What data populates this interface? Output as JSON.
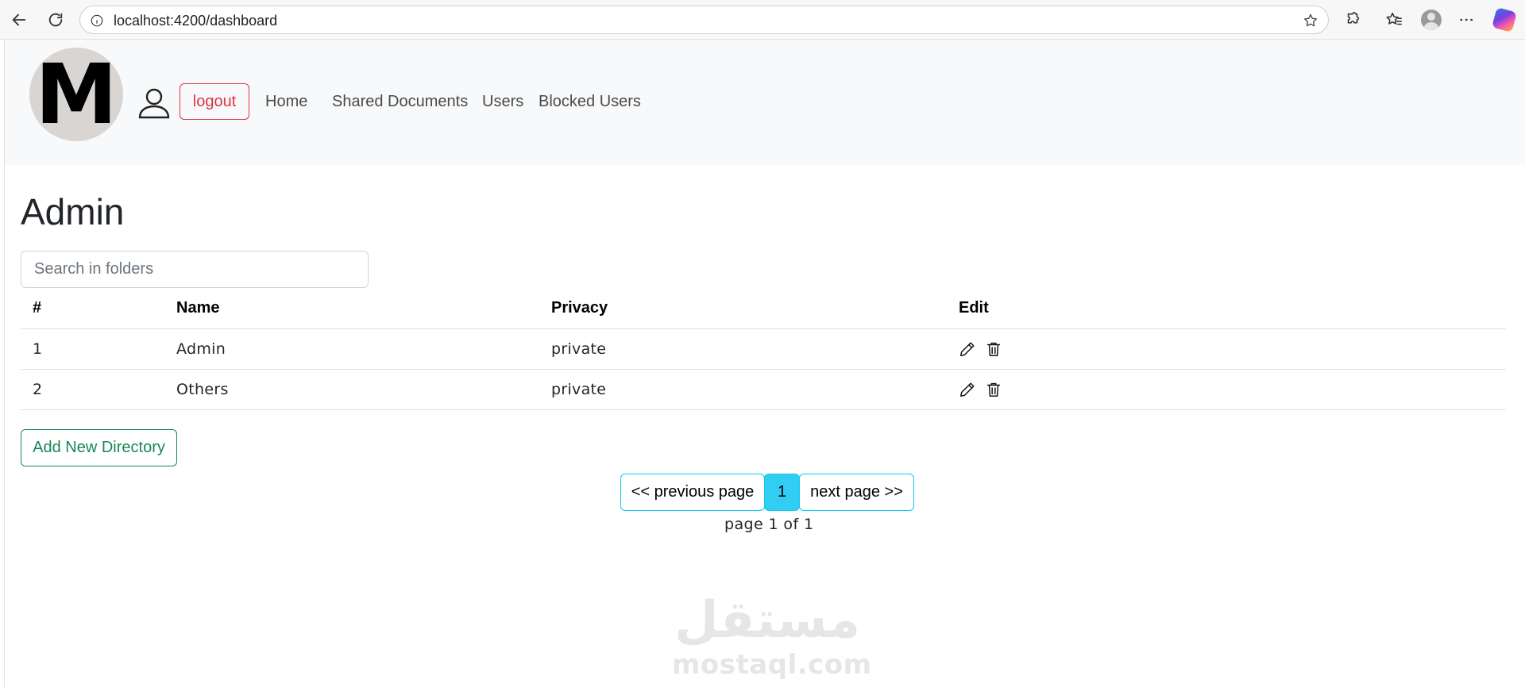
{
  "browser": {
    "url": "localhost:4200/dashboard",
    "icons": [
      "back-arrow-icon",
      "refresh-icon",
      "info-icon",
      "star-icon",
      "extensions-icon",
      "favorites-icon",
      "profile-icon",
      "more-icon",
      "copilot-icon"
    ]
  },
  "navbar": {
    "avatar_letter": "M",
    "logout_label": "logout",
    "links": [
      "Home",
      "Shared Documents",
      "Users",
      "Blocked Users"
    ]
  },
  "main": {
    "title": "Admin",
    "search_placeholder": "Search in folders",
    "table": {
      "headers": [
        "#",
        "Name",
        "Privacy",
        "Edit"
      ],
      "rows": [
        {
          "index": "1",
          "name": "Admin",
          "privacy": "private"
        },
        {
          "index": "2",
          "name": "Others",
          "privacy": "private"
        }
      ]
    },
    "add_button_label": "Add New Directory"
  },
  "pagination": {
    "prev_label": "<< previous page",
    "current": "1",
    "next_label": "next page >>",
    "status": "page 1 of 1"
  },
  "watermark": {
    "arabic": "مستقل",
    "latin": "mostaql.com"
  },
  "colors": {
    "danger": "#dc3545",
    "success": "#198754",
    "info": "#0dcaf0",
    "active_page": "#32cdf2",
    "navbar_bg": "#f8f9fa"
  }
}
